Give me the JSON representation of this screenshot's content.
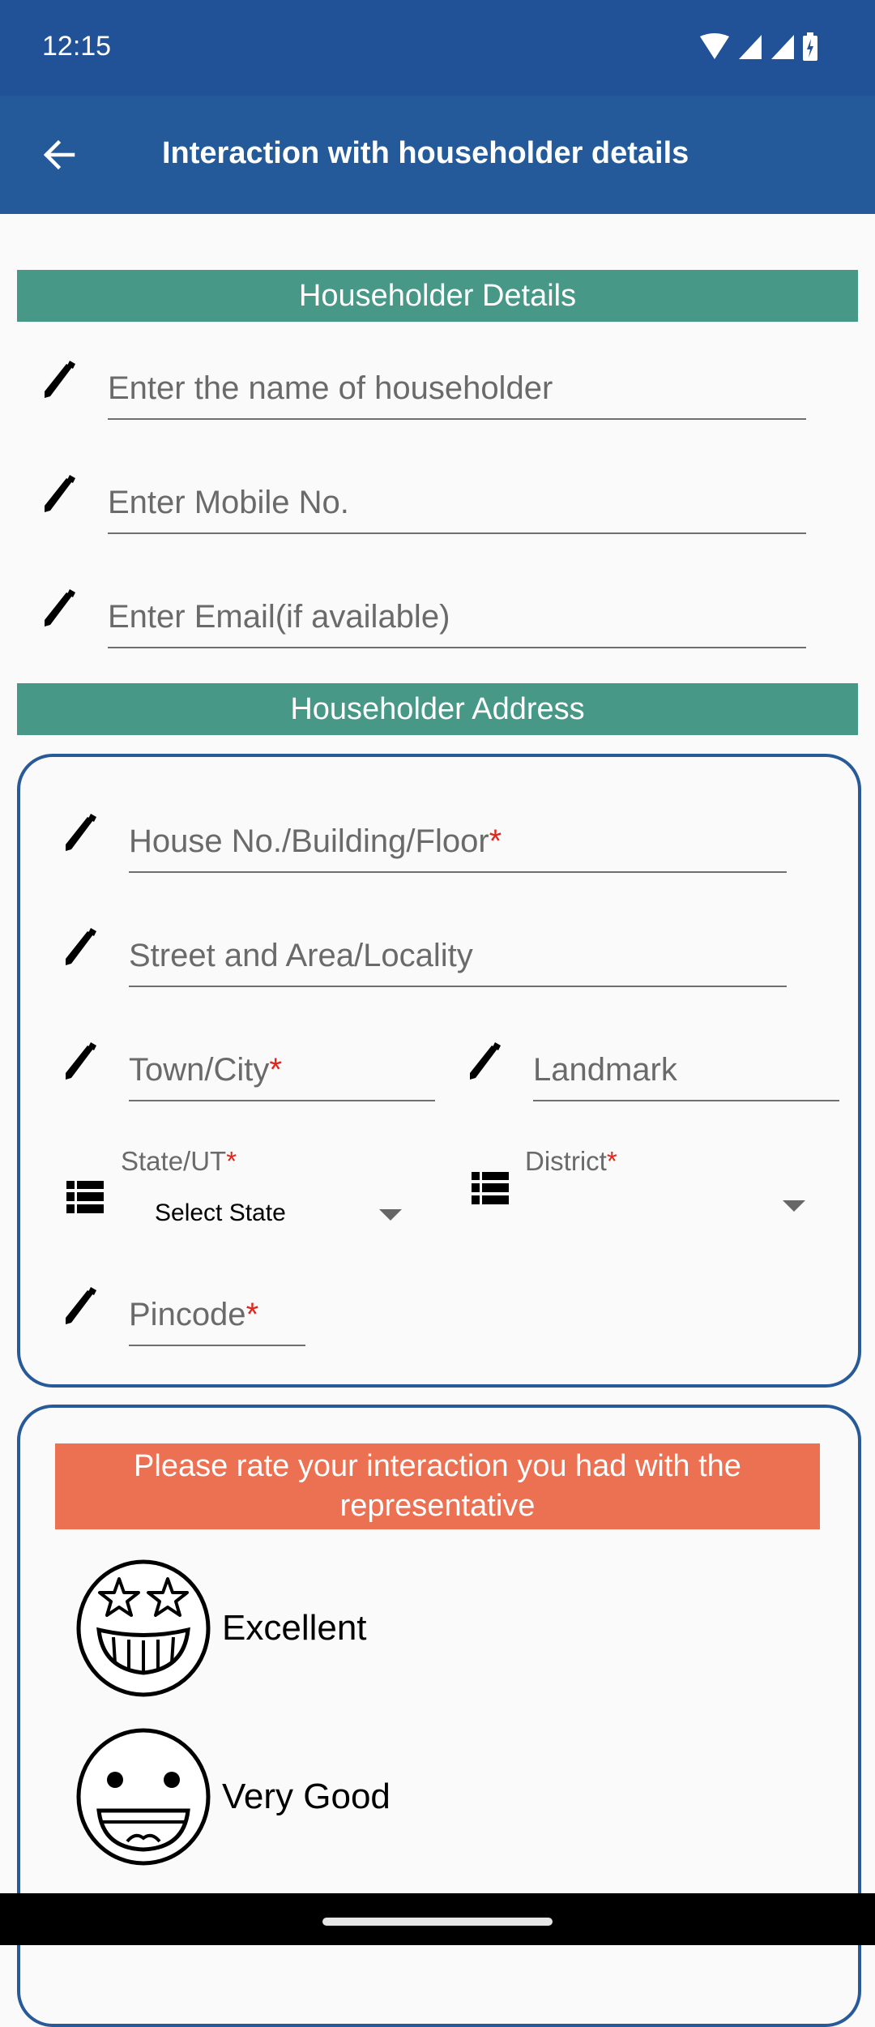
{
  "status_bar": {
    "time": "12:15",
    "icons": [
      "wifi-icon",
      "signal-icon",
      "signal-icon",
      "battery-charging-icon"
    ]
  },
  "app_bar": {
    "back_icon": "arrow-back-icon",
    "title": "Interaction with householder details"
  },
  "householder_details": {
    "header": "Householder Details",
    "fields": [
      {
        "icon": "pencil-icon",
        "placeholder": "Enter the name of householder",
        "value": ""
      },
      {
        "icon": "pencil-icon",
        "placeholder": "Enter Mobile No.",
        "value": ""
      },
      {
        "icon": "pencil-icon",
        "placeholder": "Enter Email(if available)",
        "value": ""
      }
    ]
  },
  "householder_address": {
    "header": "Householder Address",
    "required_marker": "*",
    "fields": {
      "house": {
        "placeholder": "House No./Building/Floor",
        "required": true,
        "value": ""
      },
      "street": {
        "placeholder": "Street and Area/Locality",
        "required": false,
        "value": ""
      },
      "town": {
        "placeholder": "Town/City",
        "required": true,
        "value": ""
      },
      "landmark": {
        "placeholder": "Landmark",
        "required": false,
        "value": ""
      },
      "pincode": {
        "placeholder": "Pincode",
        "required": true,
        "value": ""
      }
    },
    "dropdowns": {
      "state": {
        "label": "State/UT",
        "required": true,
        "selected": "Select State",
        "icon": "list-icon"
      },
      "district": {
        "label": "District",
        "required": true,
        "selected": "",
        "icon": "list-icon"
      }
    }
  },
  "rating": {
    "prompt": "Please rate your interaction you had with the representative",
    "options": [
      {
        "label": "Excellent",
        "icon": "star-eyes-grin-emoji-icon"
      },
      {
        "label": "Very Good",
        "icon": "big-smile-emoji-icon"
      }
    ]
  },
  "colors": {
    "status_bar": "#215196",
    "app_bar": "#245a9a",
    "section_header": "#479886",
    "card_border": "#285a99",
    "rating_banner": "#ec7052",
    "required": "#e0261c"
  }
}
